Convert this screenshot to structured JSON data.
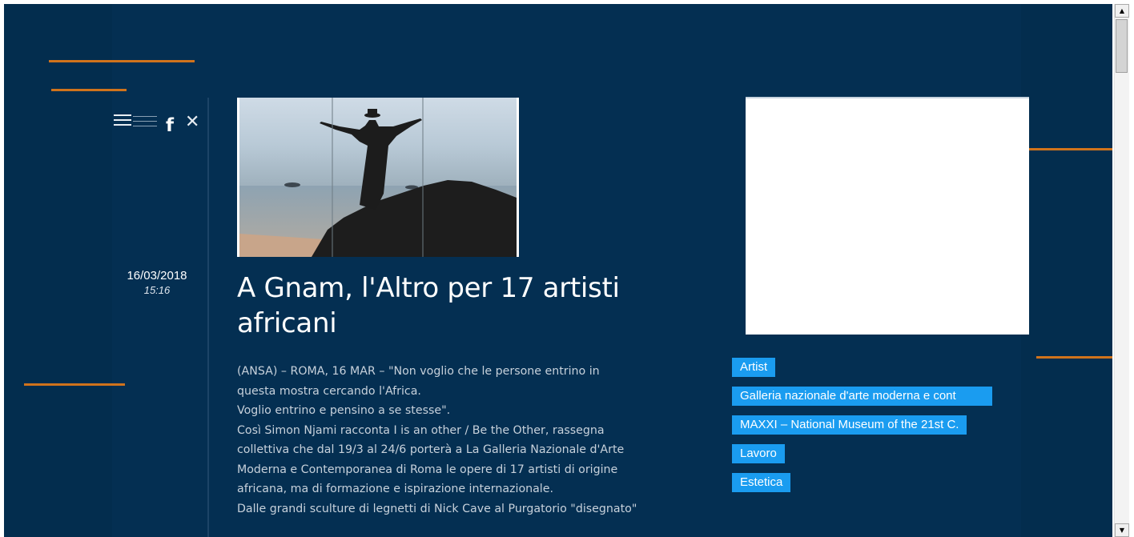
{
  "header": {
    "menu_icon": "hamburger-icon",
    "social": [
      {
        "icon": "facebook-icon",
        "glyph": "f"
      },
      {
        "icon": "x-icon",
        "glyph": "✕"
      }
    ]
  },
  "article": {
    "date": "16/03/2018",
    "time": "15:16",
    "title": "A Gnam, l'Altro per 17 artisti africani",
    "paragraph_lines": [
      "(ANSA) – ROMA, 16 MAR – \"Non voglio che le persone entrino in",
      "questa mostra cercando l'Africa.",
      "Voglio entrino e pensino a se stesse\".",
      "Così Simon Njami racconta I is an other / Be the Other, rassegna",
      "collettiva che dal 19/3 al 24/6 porterà a La Galleria Nazionale d'Arte",
      "Moderna e Contemporanea di Roma le opere di 17 artisti di origine",
      "africana, ma di formazione e ispirazione internazionale.",
      "Dalle grandi sculture di legnetti di Nick Cave al Purgatorio \"disegnato\""
    ]
  },
  "sidebar": {
    "tags": [
      "Artist",
      "Galleria nazionale d'arte moderna e cont",
      "MAXXI – National Museum of the 21st C.",
      "Lavoro",
      "Estetica"
    ]
  },
  "colors": {
    "background": "#032d4e",
    "accent_line": "#d0731c",
    "tag_background": "#1a9cf0"
  }
}
